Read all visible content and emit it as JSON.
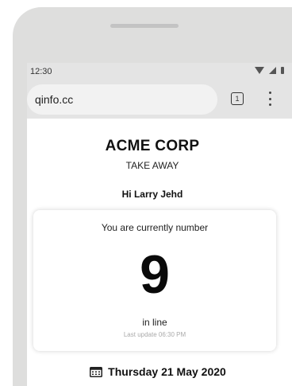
{
  "status_bar": {
    "time": "12:30",
    "icons": [
      "wifi-icon",
      "signal-icon",
      "battery-icon"
    ]
  },
  "browser": {
    "url": "qinfo.cc",
    "tab_count": "1",
    "menu_icon": "more-vert-icon"
  },
  "page": {
    "company": "ACME CORP",
    "service": "TAKE AWAY",
    "greeting": "Hi Larry Jehd",
    "queue_card": {
      "heading": "You are currently number",
      "number": "9",
      "suffix": "in line",
      "last_update": "Last update 06:30 PM"
    },
    "date": {
      "icon": "calendar-icon",
      "text": "Thursday 21 May 2020"
    }
  },
  "colors": {
    "device_frame": "#dededd",
    "browser_chrome": "#e4e4e4",
    "page_background": "#ffffff",
    "text_primary": "#111111"
  }
}
